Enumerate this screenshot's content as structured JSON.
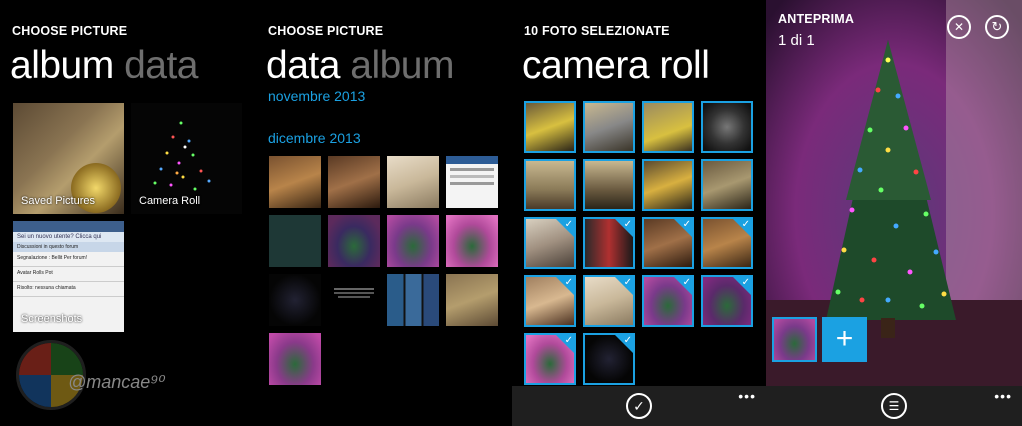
{
  "panel_album": {
    "small_title": "CHOOSE PICTURE",
    "pivot_active": "album",
    "pivot_inactive": "data",
    "tiles": [
      {
        "label": "Saved Pictures"
      },
      {
        "label": "Camera Roll"
      },
      {
        "label": "Screenshots"
      }
    ],
    "screenshot_lines": [
      "Sei un nuovo utente? Clicca qui",
      "Discussioni in questo forum",
      "Segnalazione : Bellit Per forum!",
      "Avatar Rolls Pot",
      "Risolto: nessuna chiamata"
    ],
    "watermark": "@mancae⁹⁰"
  },
  "panel_date": {
    "small_title": "CHOOSE PICTURE",
    "pivot_active": "data",
    "pivot_inactive": "album",
    "months": [
      "novembre 2013",
      "dicembre 2013"
    ]
  },
  "panel_camera_roll": {
    "small_title": "10 FOTO SELEZIONATE",
    "title": "camera roll",
    "check_mark": "✓"
  },
  "panel_preview": {
    "small_title": "ANTEPRIMA",
    "counter": "1 di 1",
    "close_icon": "✕",
    "rotate_icon": "↻",
    "add_label": "+"
  },
  "appbar": {
    "more": "•••",
    "confirm_icon": "✓",
    "send_icon": "☰"
  },
  "colors": {
    "accent": "#1ba1e2",
    "background": "#000000",
    "appbar": "#1f1f1f"
  }
}
